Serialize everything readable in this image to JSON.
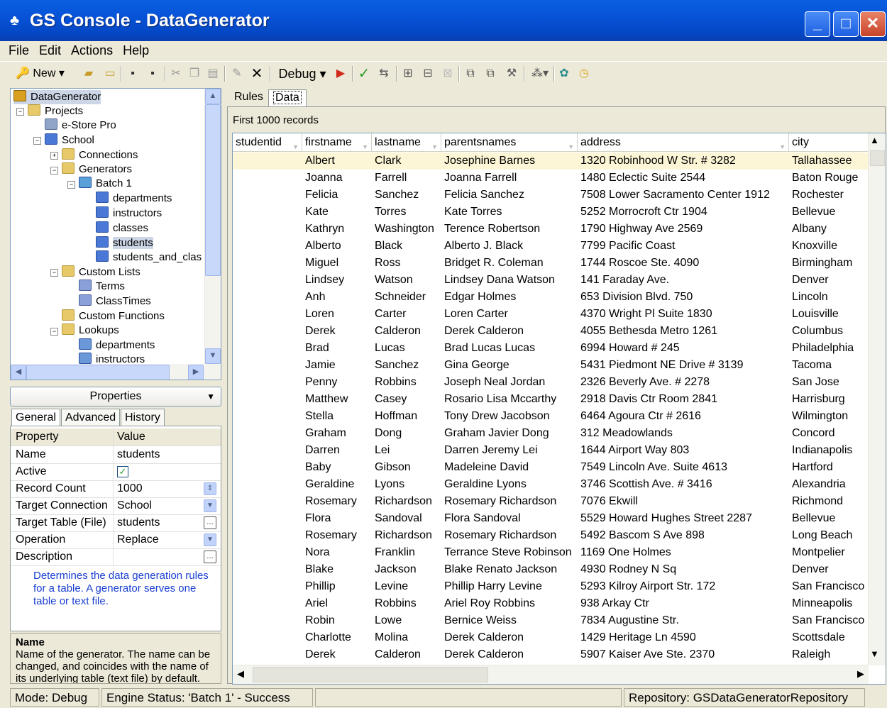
{
  "window": {
    "title": "GS Console - DataGenerator",
    "minimize": "_",
    "maximize": "□",
    "close": "✕"
  },
  "menu": [
    "File",
    "Edit",
    "Actions",
    "Help"
  ],
  "toolbar": {
    "new_label": "New",
    "debug_label": "Debug"
  },
  "tree": {
    "nodes": [
      {
        "label": "DataGenerator"
      },
      {
        "label": "Projects"
      },
      {
        "label": "e-Store Pro"
      },
      {
        "label": "School"
      },
      {
        "label": "Connections"
      },
      {
        "label": "Generators"
      },
      {
        "label": "Batch 1"
      },
      {
        "label": "departments"
      },
      {
        "label": "instructors"
      },
      {
        "label": "classes"
      },
      {
        "label": "students"
      },
      {
        "label": "students_and_clas"
      },
      {
        "label": "Custom Lists"
      },
      {
        "label": "Terms"
      },
      {
        "label": "ClassTimes"
      },
      {
        "label": "Custom Functions"
      },
      {
        "label": "Lookups"
      },
      {
        "label": "departments"
      },
      {
        "label": "instructors"
      }
    ]
  },
  "properties": {
    "header": "Properties",
    "tabs": [
      "General",
      "Advanced",
      "History"
    ],
    "col_property": "Property",
    "col_value": "Value",
    "rows": [
      {
        "k": "Name",
        "v": "students"
      },
      {
        "k": "Active",
        "v": "✓"
      },
      {
        "k": "Record Count",
        "v": "1000"
      },
      {
        "k": "Target Connection",
        "v": "School"
      },
      {
        "k": "Target Table (File)",
        "v": "students"
      },
      {
        "k": "Operation",
        "v": "Replace"
      },
      {
        "k": "Description",
        "v": ""
      }
    ],
    "description": "Determines the data generation rules for a table. A generator serves one table or text file.",
    "help_title": "Name",
    "help_text": "Name of the generator. The name can be changed, and coincides with the name of its underlying table (text file) by default."
  },
  "main": {
    "tabs": [
      "Rules",
      "Data"
    ],
    "records_label": "First 1000 records",
    "columns": [
      "studentid",
      "firstname",
      "lastname",
      "parentsnames",
      "address",
      "city"
    ],
    "rows": [
      [
        "",
        "Albert",
        "Clark",
        "Josephine Barnes",
        "1320 Robinhood W Str. # 3282",
        "Tallahassee"
      ],
      [
        "",
        "Joanna",
        "Farrell",
        "Joanna Farrell",
        "1480 Eclectic  Suite 2544",
        "Baton Rouge"
      ],
      [
        "",
        "Felicia",
        "Sanchez",
        "Felicia Sanchez",
        "7508 Lower Sacramento  Center 1912",
        "Rochester"
      ],
      [
        "",
        "Kate",
        "Torres",
        "Kate Torres",
        "5252 Morrocroft Ctr 1904",
        "Bellevue"
      ],
      [
        "",
        "Kathryn",
        "Washington",
        "Terence Robertson",
        "1790 Highway Ave 2569",
        "Albany"
      ],
      [
        "",
        "Alberto",
        "Black",
        "Alberto J. Black",
        "7799 Pacific Coast",
        "Knoxville"
      ],
      [
        "",
        "Miguel",
        "Ross",
        "Bridget R. Coleman",
        "1744 Roscoe  Ste. 4090",
        "Birmingham"
      ],
      [
        "",
        "Lindsey",
        "Watson",
        "Lindsey Dana Watson",
        "141 Faraday Ave.",
        "Denver"
      ],
      [
        "",
        "Anh",
        "Schneider",
        "Edgar Holmes",
        "653 Division  Blvd. 750",
        "Lincoln"
      ],
      [
        "",
        "Loren",
        "Carter",
        "Loren Carter",
        "4370 Wright Pl Suite 1830",
        "Louisville"
      ],
      [
        "",
        "Derek",
        "Calderon",
        "Derek Calderon",
        "4055 Bethesda Metro   1261",
        "Columbus"
      ],
      [
        "",
        "Brad",
        "Lucas",
        "Brad Lucas Lucas",
        "6994 Howard  # 245",
        "Philadelphia"
      ],
      [
        "",
        "Jamie",
        "Sanchez",
        "Gina George",
        "5431 Piedmont NE Drive # 3139",
        "Tacoma"
      ],
      [
        "",
        "Penny",
        "Robbins",
        "Joseph Neal Jordan",
        "2326 Beverly Ave. # 2278",
        "San Jose"
      ],
      [
        "",
        "Matthew",
        "Casey",
        "Rosario Lisa Mccarthy",
        "2918 Davis  Ctr Room 2841",
        "Harrisburg"
      ],
      [
        "",
        "Stella",
        "Hoffman",
        "Tony Drew Jacobson",
        "6464 Agoura  Ctr # 2616",
        "Wilmington"
      ],
      [
        "",
        "Graham",
        "Dong",
        "Graham Javier Dong",
        "312 Meadowlands",
        "Concord"
      ],
      [
        "",
        "Darren",
        "Lei",
        "Darren Jeremy Lei",
        "1644 Airport  Way  803",
        "Indianapolis"
      ],
      [
        "",
        "Baby",
        "Gibson",
        "Madeleine David",
        "7549 Lincoln  Ave. Suite 4613",
        "Hartford"
      ],
      [
        "",
        "Geraldine",
        "Lyons",
        "Geraldine Lyons",
        "3746 Scottish  Ave. # 3416",
        "Alexandria"
      ],
      [
        "",
        "Rosemary",
        "Richardson",
        "Rosemary Richardson",
        "7076 Ekwill",
        "Richmond"
      ],
      [
        "",
        "Flora",
        "Sandoval",
        "Flora Sandoval",
        "5529 Howard Hughes  Street 2287",
        "Bellevue"
      ],
      [
        "",
        "Rosemary",
        "Richardson",
        "Rosemary Richardson",
        "5492 Bascom S Ave  898",
        "Long Beach"
      ],
      [
        "",
        "Nora",
        "Franklin",
        "Terrance Steve Robinson",
        "1169 One Holmes",
        "Montpelier"
      ],
      [
        "",
        "Blake",
        "Jackson",
        "Blake Renato Jackson",
        "4930 Rodney N Sq",
        "Denver"
      ],
      [
        "",
        "Phillip",
        "Levine",
        "Phillip Harry Levine",
        "5293 Kilroy Airport  Str.  172",
        "San Francisco"
      ],
      [
        "",
        "Ariel",
        "Robbins",
        "Ariel Roy Robbins",
        "938 Arkay  Ctr",
        "Minneapolis"
      ],
      [
        "",
        "Robin",
        "Lowe",
        "Bernice Weiss",
        "7834 Augustine  Str.",
        "San Francisco"
      ],
      [
        "",
        "Charlotte",
        "Molina",
        "Derek Calderon",
        "1429 Heritage  Ln  4590",
        "Scottsdale"
      ],
      [
        "",
        "Derek",
        "Calderon",
        "Derek Calderon",
        "5907 Kaiser  Ave Ste. 2370",
        "Raleigh"
      ]
    ]
  },
  "status": {
    "mode": "Mode: Debug",
    "engine": "Engine Status: 'Batch 1' - Success",
    "repository": "Repository: GSDataGeneratorRepository"
  },
  "colors": {
    "title_blue": "#0753d8",
    "row_highlight": "#fcf6d6",
    "link_blue": "#1a3fd1"
  }
}
